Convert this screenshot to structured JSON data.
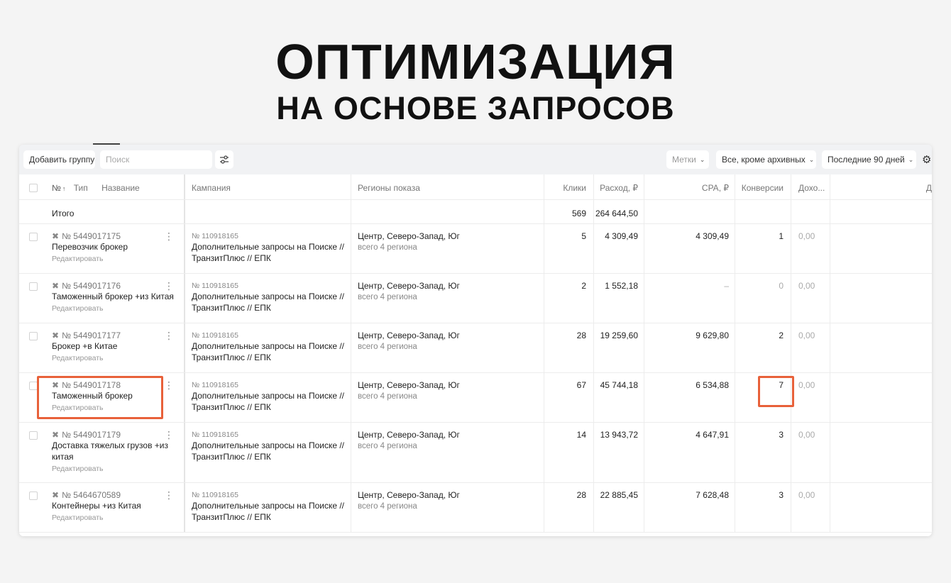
{
  "header": {
    "title": "ОПТИМИЗАЦИЯ",
    "subtitle": "НА ОСНОВЕ ЗАПРОСОВ"
  },
  "toolbar": {
    "add_group_label": "Добавить группу",
    "search_placeholder": "Поиск",
    "tags_label": "Метки",
    "status_filter": "Все, кроме архивных",
    "period_filter": "Последние 90 дней"
  },
  "columns": {
    "number": "№",
    "type": "Тип",
    "name": "Название",
    "campaign": "Кампания",
    "regions": "Регионы показа",
    "clicks": "Клики",
    "spend": "Расход, ₽",
    "cpa": "CPA, ₽",
    "conversions": "Конверсии",
    "income": "Дохо...",
    "extra": "Д"
  },
  "total": {
    "label": "Итого",
    "clicks": "569",
    "spend": "264 644,50"
  },
  "rows": [
    {
      "id": "№ 5449017175",
      "name": "Перевозчик брокер",
      "edit": "Редактировать",
      "campaign_id": "№ 110918165",
      "campaign": "Дополнительные запросы на Поиске // ТранзитПлюс // ЕПК",
      "regions": "Центр, Северо-Запад, Юг",
      "regions_sub": "всего 4 региона",
      "clicks": "5",
      "spend": "4 309,49",
      "cpa": "4 309,49",
      "conversions": "1",
      "income": "0,00"
    },
    {
      "id": "№ 5449017176",
      "name": "Таможенный брокер +из Китая",
      "edit": "Редактировать",
      "campaign_id": "№ 110918165",
      "campaign": "Дополнительные запросы на Поиске // ТранзитПлюс // ЕПК",
      "regions": "Центр, Северо-Запад, Юг",
      "regions_sub": "всего 4 региона",
      "clicks": "2",
      "spend": "1 552,18",
      "cpa": "–",
      "conversions": "0",
      "income": "0,00"
    },
    {
      "id": "№ 5449017177",
      "name": "Брокер +в Китае",
      "edit": "Редактировать",
      "campaign_id": "№ 110918165",
      "campaign": "Дополнительные запросы на Поиске // ТранзитПлюс // ЕПК",
      "regions": "Центр, Северо-Запад, Юг",
      "regions_sub": "всего 4 региона",
      "clicks": "28",
      "spend": "19 259,60",
      "cpa": "9 629,80",
      "conversions": "2",
      "income": "0,00"
    },
    {
      "id": "№ 5449017178",
      "name": "Таможенный брокер",
      "edit": "Редактировать",
      "campaign_id": "№ 110918165",
      "campaign": "Дополнительные запросы на Поиске // ТранзитПлюс // ЕПК",
      "regions": "Центр, Северо-Запад, Юг",
      "regions_sub": "всего 4 региона",
      "clicks": "67",
      "spend": "45 744,18",
      "cpa": "6 534,88",
      "conversions": "7",
      "income": "0,00"
    },
    {
      "id": "№ 5449017179",
      "name": "Доставка тяжелых грузов +из китая",
      "edit": "Редактировать",
      "campaign_id": "№ 110918165",
      "campaign": "Дополнительные запросы на Поиске // ТранзитПлюс // ЕПК",
      "regions": "Центр, Северо-Запад, Юг",
      "regions_sub": "всего 4 региона",
      "clicks": "14",
      "spend": "13 943,72",
      "cpa": "4 647,91",
      "conversions": "3",
      "income": "0,00"
    },
    {
      "id": "№ 5464670589",
      "name": "Контейнеры +из Китая",
      "edit": "Редактировать",
      "campaign_id": "№ 110918165",
      "campaign": "Дополнительные запросы на Поиске // ТранзитПлюс // ЕПК",
      "regions": "Центр, Северо-Запад, Юг",
      "regions_sub": "всего 4 региона",
      "clicks": "28",
      "spend": "22 885,45",
      "cpa": "7 628,48",
      "conversions": "3",
      "income": "0,00"
    }
  ],
  "colors": {
    "highlight": "#e8613a",
    "toolbar_bg": "#f1f2f4"
  }
}
